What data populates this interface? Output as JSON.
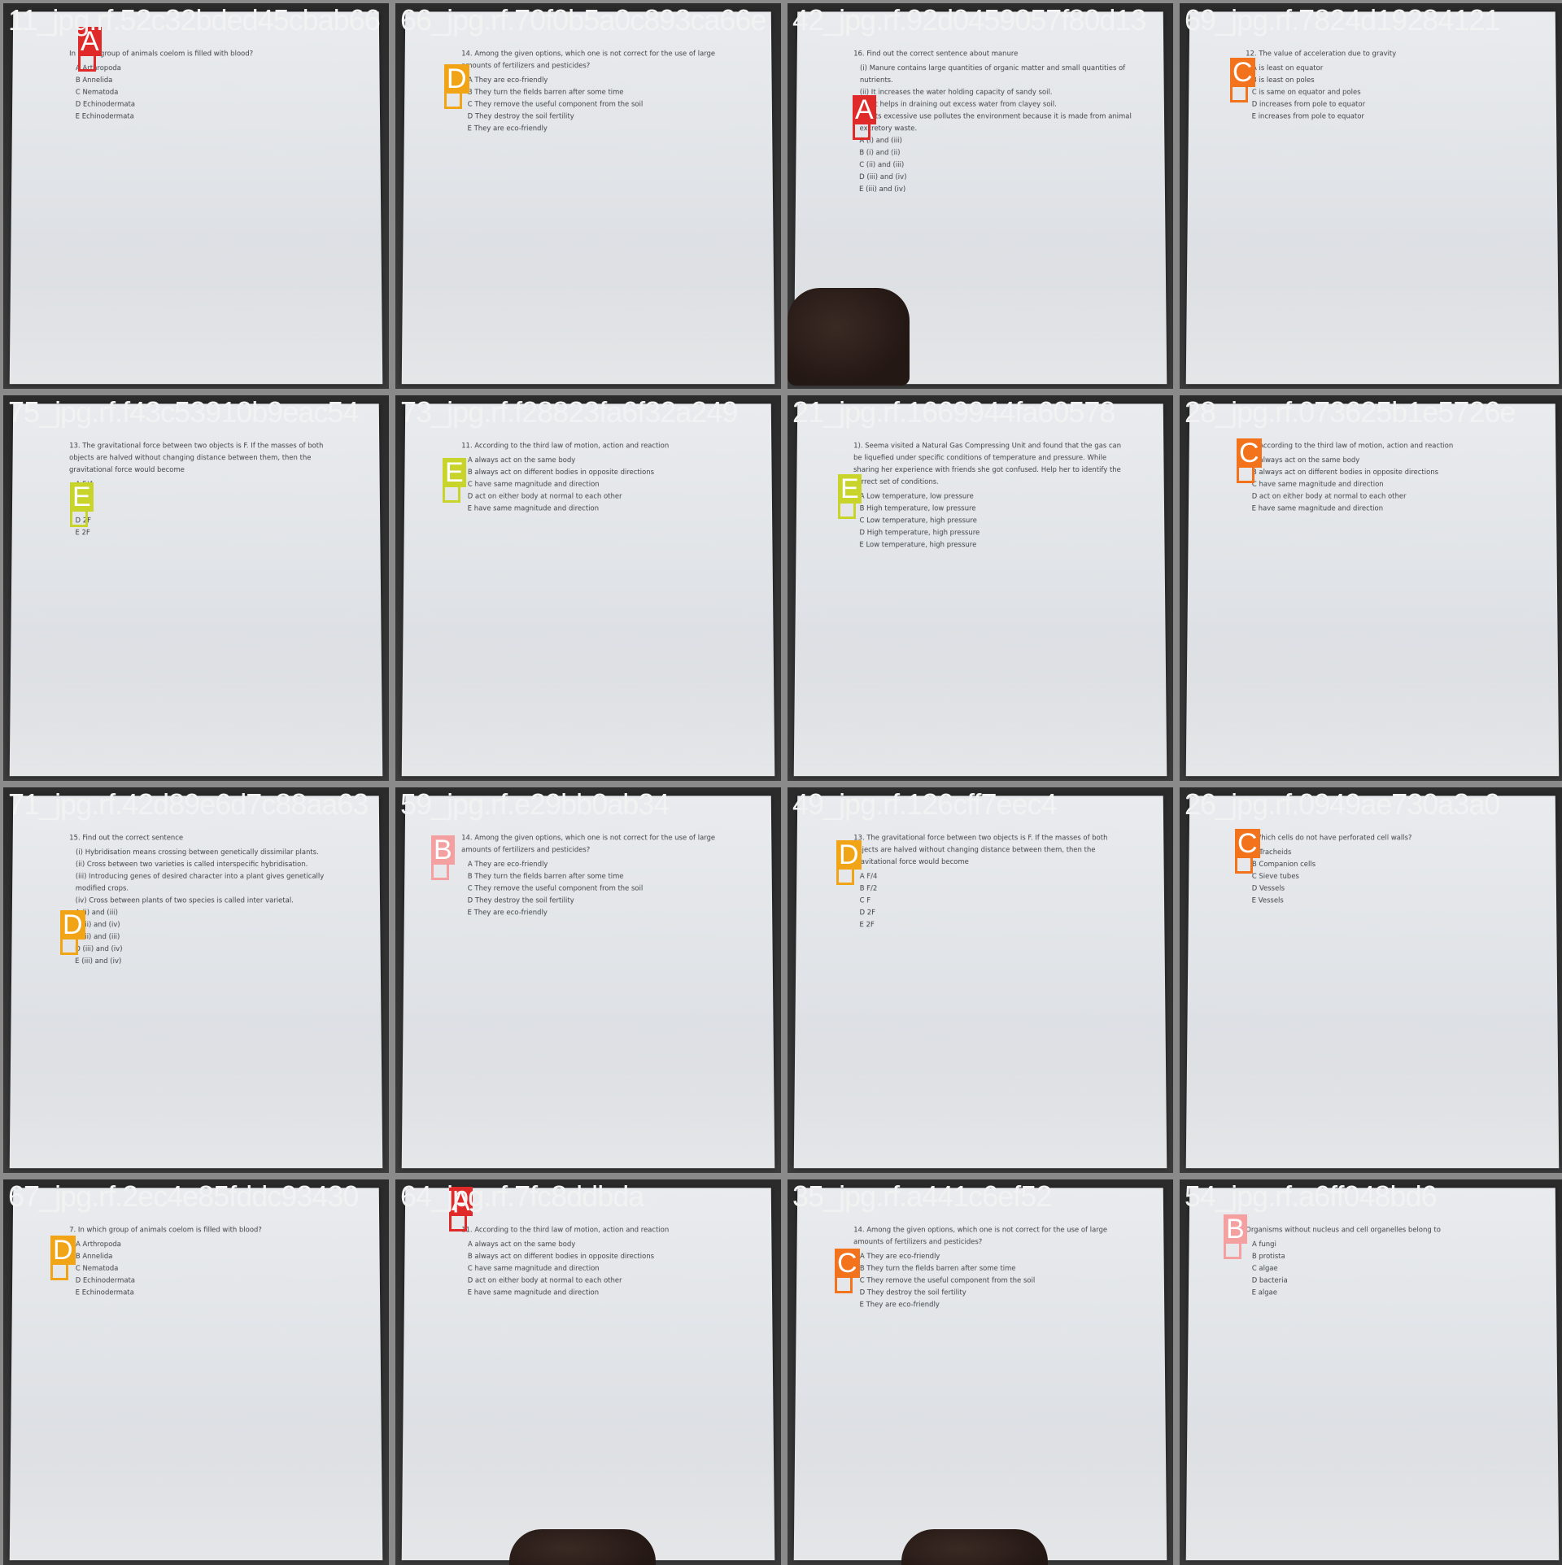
{
  "tiles": [
    {
      "filename": "11_jpg.rf.52c32bded45cbab66",
      "label": "A",
      "color": "#e02a2a",
      "question": "In which group of animals coelom is filled with blood?",
      "options": [
        "A Arthropoda",
        "B Annelida",
        "C Nematoda",
        "D Echinodermata",
        "E Echinodermata"
      ]
    },
    {
      "filename": "66_jpg.rf.70f0b5a0c893ca66e",
      "label": "D",
      "color": "#f2a417",
      "question": "14. Among the given options, which one is not correct for the use of large amounts of fertilizers and pesticides?",
      "options": [
        "A They are eco-friendly",
        "B They turn the fields barren after some time",
        "C They remove the useful component from the soil",
        "D They destroy the soil fertility",
        "E They are eco-friendly"
      ]
    },
    {
      "filename": "42_jpg.rf.92d0459057f80d13",
      "label": "A",
      "color": "#e02a2a",
      "question": "16. Find out the correct sentence about manure",
      "options": [
        "(i) Manure contains large quantities of organic matter and small quantities of nutrients.",
        "(ii) It increases the water holding capacity of sandy soil.",
        "(iii) It helps in draining out excess water from clayey soil.",
        "(iv) Its excessive use pollutes the environment because it is made from animal excretory waste.",
        "A (i) and (iii)",
        "B (i) and (ii)",
        "C (ii) and (iii)",
        "D (iii) and (iv)",
        "E (iii) and (iv)"
      ]
    },
    {
      "filename": "69_jpg.rf.7824d19284121",
      "label": "C",
      "color": "#f2731c",
      "question": "12. The value of acceleration due to gravity",
      "options": [
        "A is least on equator",
        "B is least on poles",
        "C is same on equator and poles",
        "D increases from pole to equator",
        "E increases from pole to equator"
      ]
    },
    {
      "filename": "75_jpg.rf.f43c53910b9eac54",
      "label": "E",
      "color": "#c8d42a",
      "question": "13. The gravitational force between two objects is F. If the masses of both objects are halved without changing distance between them, then the gravitational force would become",
      "options": [
        "A F/4",
        "B F/2",
        "C F",
        "D 2F",
        "E 2F"
      ]
    },
    {
      "filename": "73_jpg.rf.f28823fa6f32a249",
      "label": "E",
      "color": "#c8d42a",
      "question": "11. According to the third law of motion, action and reaction",
      "options": [
        "A always act on the same body",
        "B always act on different bodies in opposite directions",
        "C have same magnitude and direction",
        "D act on either body at normal to each other",
        "E have same magnitude and direction"
      ]
    },
    {
      "filename": "21_jpg.rf.1669944fa60578",
      "label": "E",
      "color": "#c8d42a",
      "question": "1). Seema visited a Natural Gas Compressing Unit and found that the gas can be liquefied under specific conditions of temperature and pressure. While sharing her experience with friends she got confused. Help her to identify the correct set of conditions.",
      "options": [
        "A Low temperature, low pressure",
        "B High temperature, low pressure",
        "C Low temperature, high pressure",
        "D High temperature, high pressure",
        "E Low temperature, high pressure"
      ]
    },
    {
      "filename": "28_jpg.rf.073625b1e5726e",
      "label": "C",
      "color": "#f2731c",
      "question": "11. According to the third law of motion, action and reaction",
      "options": [
        "A always act on the same body",
        "B always act on different bodies in opposite directions",
        "C have same magnitude and direction",
        "D act on either body at normal to each other",
        "E have same magnitude and direction"
      ]
    },
    {
      "filename": "71_jpg.rf.42d89e6d7c88aa63",
      "label": "D",
      "color": "#f2a417",
      "question": "15. Find out the correct sentence",
      "options": [
        "(i) Hybridisation means crossing between genetically dissimilar plants.",
        "(ii) Cross between two varieties is called interspecific hybridisation.",
        "(iii) Introducing genes of desired character into a plant gives genetically modified crops.",
        "(iv) Cross between plants of two species is called inter varietal.",
        "A (i) and (iii)",
        "B (ii) and (iv)",
        "C (ii) and (iii)",
        "D (iii) and (iv)",
        "E (iii) and (iv)"
      ]
    },
    {
      "filename": "59_jpg.rf.e29bb0ab34",
      "label": "B",
      "color": "#f4a0a0",
      "question": "14. Among the given options, which one is not correct for the use of large amounts of fertilizers and pesticides?",
      "options": [
        "A They are eco-friendly",
        "B They turn the fields barren after some time",
        "C They remove the useful component from the soil",
        "D They destroy the soil fertility",
        "E They are eco-friendly"
      ]
    },
    {
      "filename": "49_jpg.rf.126cff7eec4",
      "label": "D",
      "color": "#f2a417",
      "question": "13. The gravitational force between two objects is F. If the masses of both objects are halved without changing distance between them, then the gravitational force would become",
      "options": [
        "A F/4",
        "B F/2",
        "C F",
        "D 2F",
        "E 2F"
      ]
    },
    {
      "filename": "26_jpg.rf.0949ae730a3a0",
      "label": "C",
      "color": "#f2731c",
      "question": "9. Which cells do not have perforated cell walls?",
      "options": [
        "A Tracheids",
        "B Companion cells",
        "C Sieve tubes",
        "D Vessels",
        "E Vessels"
      ]
    },
    {
      "filename": "67_jpg.rf.2ec4e85fddc93430",
      "label": "D",
      "color": "#f2a417",
      "question": "7. In which group of animals coelom is filled with blood?",
      "options": [
        "A Arthropoda",
        "B Annelida",
        "C Nematoda",
        "D Echinodermata",
        "E Echinodermata"
      ]
    },
    {
      "filename": "64_jpg.rf.7fc8ddbda",
      "label": "A",
      "color": "#e02a2a",
      "question": "11. According to the third law of motion, action and reaction",
      "options": [
        "A always act on the same body",
        "B always act on different bodies in opposite directions",
        "C have same magnitude and direction",
        "D act on either body at normal to each other",
        "E have same magnitude and direction"
      ]
    },
    {
      "filename": "35_jpg.rf.a441c6ef52",
      "label": "C",
      "color": "#f2731c",
      "question": "14. Among the given options, which one is not correct for the use of large amounts of fertilizers and pesticides?",
      "options": [
        "A They are eco-friendly",
        "B They turn the fields barren after some time",
        "C They remove the useful component from the soil",
        "D They destroy the soil fertility",
        "E They are eco-friendly"
      ]
    },
    {
      "filename": "54_jpg.rf.a6ff048bd6",
      "label": "B",
      "color": "#f4a0a0",
      "question": "Organisms without nucleus and cell organelles belong to",
      "options": [
        "A fungi",
        "B protista",
        "C algae",
        "D bacteria",
        "E algae"
      ]
    }
  ]
}
